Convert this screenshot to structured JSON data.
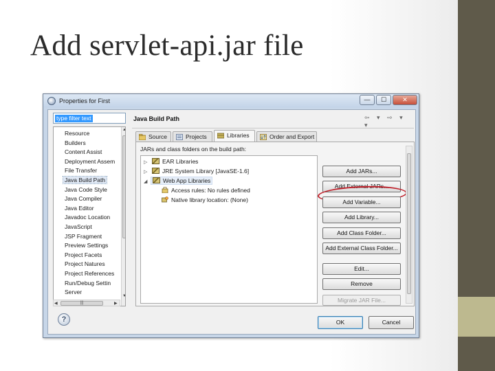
{
  "slide": {
    "title": "Add servlet-api.jar file"
  },
  "dialog": {
    "title": "Properties for First",
    "window_buttons": {
      "minimize": "—",
      "maximize": "☐",
      "close": "✕"
    },
    "filter_placeholder": "type filter text",
    "nav_items": [
      "Resource",
      "Builders",
      "Content Assist",
      "Deployment Assem",
      "File Transfer",
      "Java Build Path",
      "Java Code Style",
      "Java Compiler",
      "Java Editor",
      "Javadoc Location",
      "JavaScript",
      "JSP Fragment",
      "Preview Settings",
      "Project Facets",
      "Project Natures",
      "Project References",
      "Run/Debug Settin",
      "Server"
    ],
    "selected_nav_index": 5,
    "help_glyph": "?",
    "page_title": "Java Build Path",
    "nav_arrows": "⇦ ▾ ⇨ ▾ ▾",
    "tabs": [
      "Source",
      "Projects",
      "Libraries",
      "Order and Export"
    ],
    "active_tab": "Libraries",
    "panel_label": "JARs and class folders on the build path:",
    "libraries": [
      {
        "label": "EAR Libraries",
        "icon": "library-icon"
      },
      {
        "label": "JRE System Library [JavaSE-1.6]",
        "icon": "library-icon"
      },
      {
        "label": "Web App Libraries",
        "icon": "library-icon",
        "children": [
          {
            "label": "Access rules: No rules defined",
            "icon": "access-rules-icon"
          },
          {
            "label": "Native library location: (None)",
            "icon": "native-library-icon"
          }
        ]
      }
    ],
    "buttons": [
      "Add JARs...",
      "Add External JARs...",
      "Add Variable...",
      "Add Library...",
      "Add Class Folder...",
      "Add External Class Folder...",
      "Edit...",
      "Remove",
      "Migrate JAR File..."
    ],
    "highlighted_button": "Add External JARs...",
    "ok_label": "OK",
    "cancel_label": "Cancel",
    "colors": {
      "highlight_ring": "#c0202a",
      "selection": "#3399ff"
    }
  }
}
